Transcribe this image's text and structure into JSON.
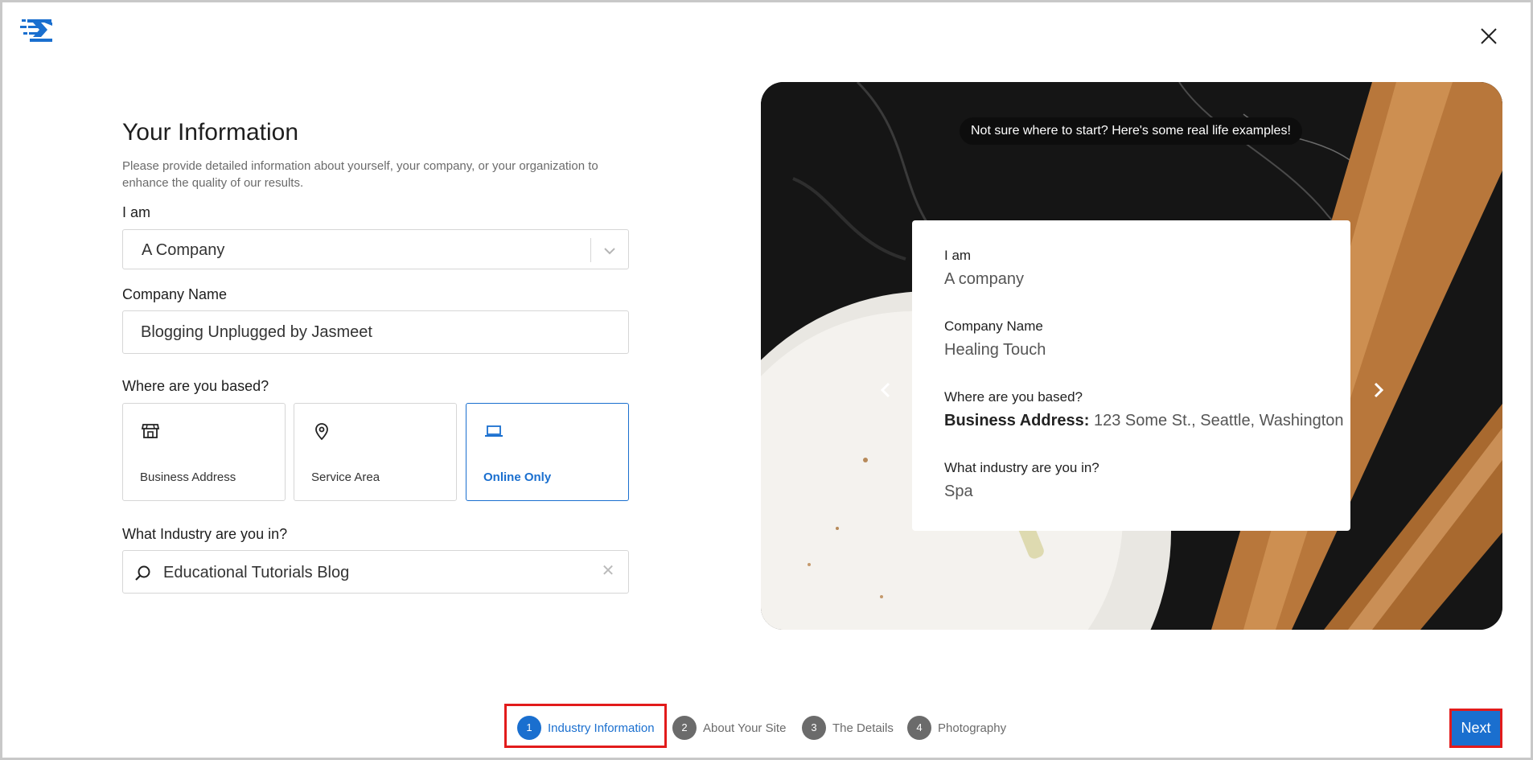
{
  "header": {
    "logo_icon": "kadence-logo-icon",
    "close_icon": "close-icon"
  },
  "form": {
    "title": "Your Information",
    "description": "Please provide detailed information about yourself, your company, or your organization to enhance the quality of our results.",
    "i_am_label": "I am",
    "i_am_value": "A Company",
    "company_label": "Company Name",
    "company_value": "Blogging Unplugged by Jasmeet",
    "based_label": "Where are you based?",
    "based_options": [
      {
        "label": "Business Address",
        "icon": "storefront-icon",
        "selected": false
      },
      {
        "label": "Service Area",
        "icon": "map-pin-icon",
        "selected": false
      },
      {
        "label": "Online Only",
        "icon": "laptop-icon",
        "selected": true
      }
    ],
    "industry_label": "What Industry are you in?",
    "industry_value": "Educational Tutorials Blog"
  },
  "example": {
    "tip": "Not sure where to start? Here's some real life examples!",
    "i_am_label": "I am",
    "i_am_value": "A company",
    "company_label": "Company Name",
    "company_value": "Healing Touch",
    "based_label": "Where are you based?",
    "based_prefix": "Business Address:",
    "based_value": "123 Some St., Seattle, Washington",
    "industry_label": "What industry are you in?",
    "industry_value": "Spa"
  },
  "stepper": {
    "steps": [
      {
        "num": "1",
        "label": "Industry Information",
        "active": true
      },
      {
        "num": "2",
        "label": "About Your Site",
        "active": false
      },
      {
        "num": "3",
        "label": "The Details",
        "active": false
      },
      {
        "num": "4",
        "label": "Photography",
        "active": false
      }
    ],
    "next_label": "Next"
  },
  "colors": {
    "accent": "#1a6fcf",
    "highlight": "#e21b1b"
  }
}
